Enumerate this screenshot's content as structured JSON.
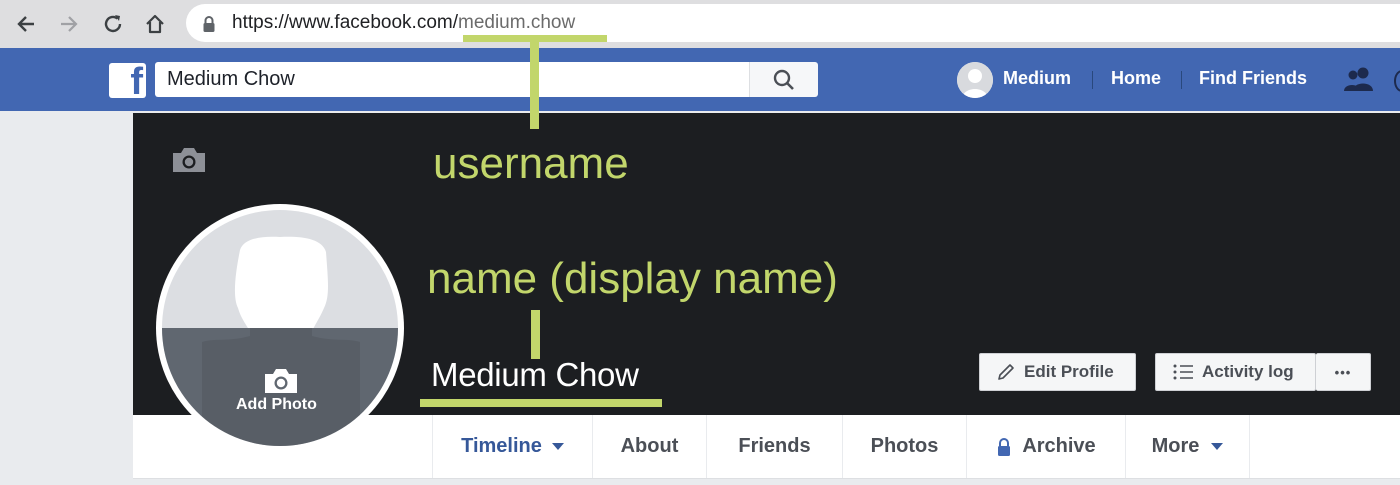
{
  "browser": {
    "url_base": "https://www.facebook.com/",
    "url_path": "medium.chow"
  },
  "header": {
    "logo": "f",
    "search_value": "Medium Chow",
    "user_name": "Medium",
    "nav_home": "Home",
    "nav_find_friends": "Find Friends"
  },
  "profile": {
    "name": "Medium Chow",
    "add_photo": "Add Photo",
    "edit_profile": "Edit Profile",
    "activity_log": "Activity log",
    "more_dots": "•••"
  },
  "tabs": [
    {
      "label": "Timeline"
    },
    {
      "label": "About"
    },
    {
      "label": "Friends"
    },
    {
      "label": "Photos"
    },
    {
      "label": "Archive"
    },
    {
      "label": "More"
    }
  ],
  "annotations": {
    "username": "username",
    "display_name": "name (display name)"
  },
  "colors": {
    "facebook_blue": "#4267b2",
    "cover": "#1c1e21",
    "annotation": "#c2d66b",
    "tab_text": "#4b4f56",
    "tab_active": "#365899"
  },
  "icons": [
    "back-arrow-icon",
    "forward-arrow-icon",
    "reload-icon",
    "home-icon",
    "lock-icon",
    "search-icon",
    "friends-icon",
    "camera-icon",
    "pencil-icon",
    "list-icon",
    "caret-down-icon"
  ]
}
